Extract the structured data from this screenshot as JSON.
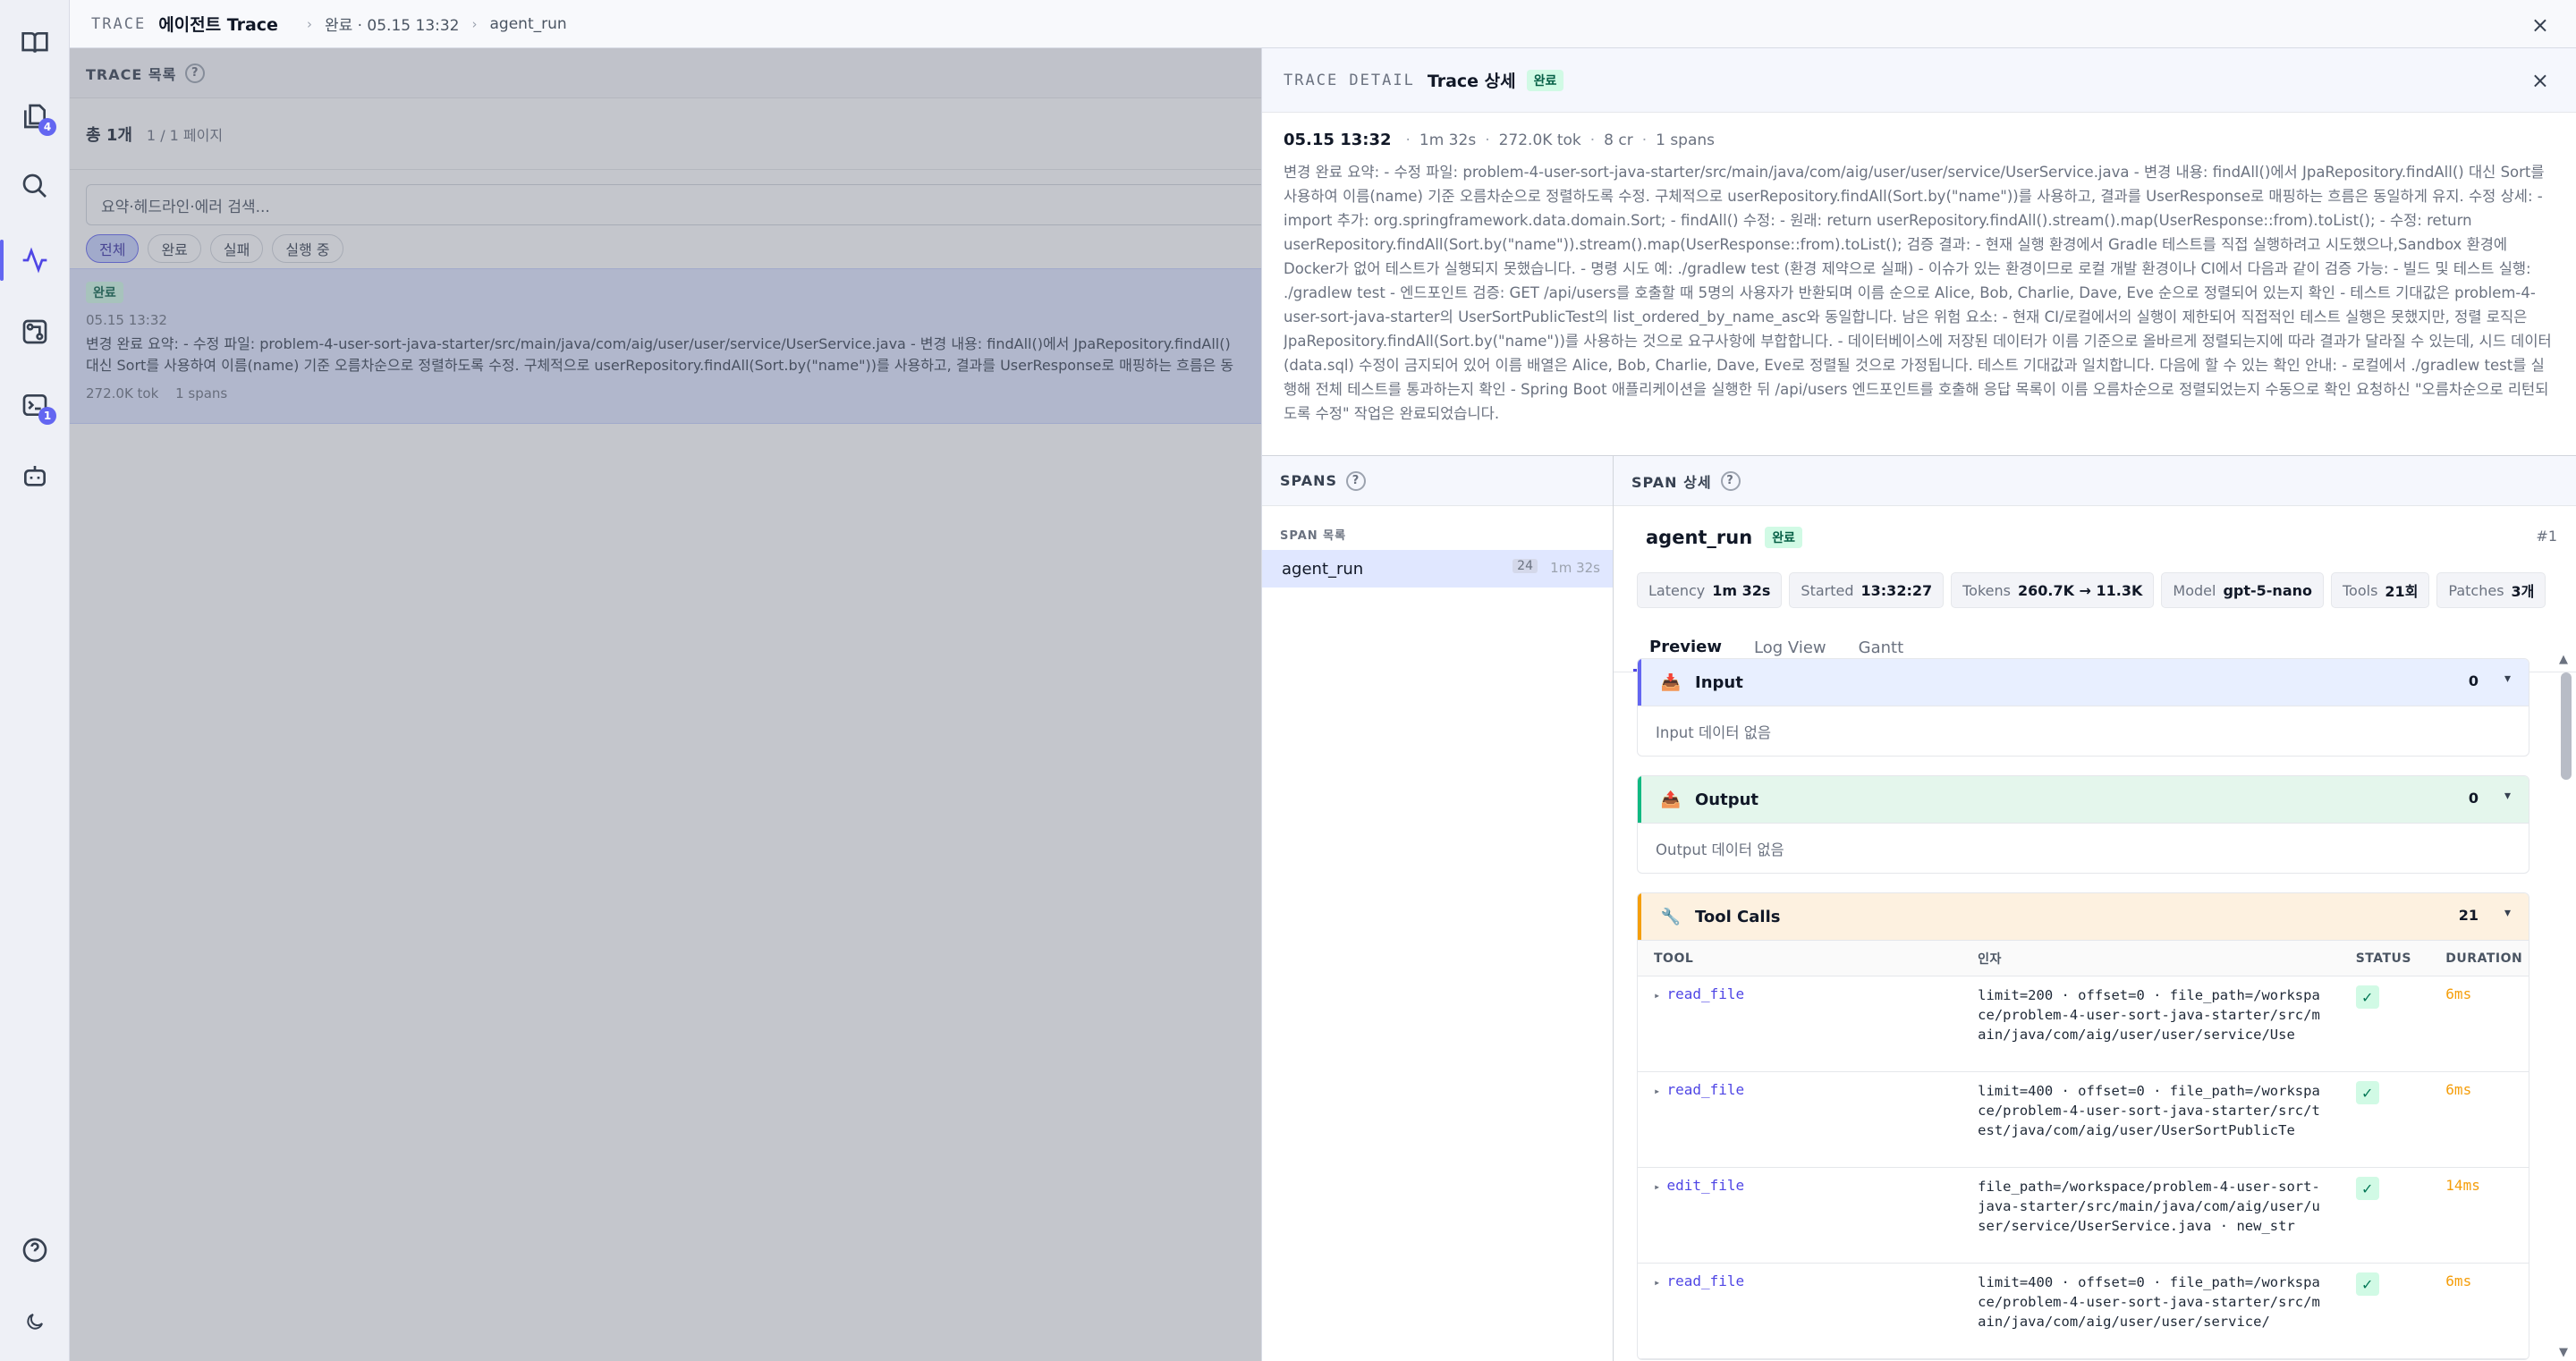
{
  "rail": {
    "badges": {
      "files": "4",
      "terminal": "1"
    }
  },
  "topbar": {
    "kicker": "TRACE",
    "title": "에이전트 Trace",
    "crumb_status": "완료 · 05.15 13:32",
    "crumb_span": "agent_run",
    "close": "×"
  },
  "list": {
    "header": "TRACE 목록",
    "total": "총 1개",
    "pages": "1 / 1 페이지",
    "search_placeholder": "요약·헤드라인·에러 검색...",
    "filters": [
      "전체",
      "완료",
      "실패",
      "실행 중"
    ],
    "row": {
      "status": "완료",
      "time": "05.15 13:32",
      "summary": "변경 완료 요약: - 수정 파일: problem-4-user-sort-java-starter/src/main/java/com/aig/user/user/service/UserService.java - 변경 내용: findAll()에서 JpaRepository.findAll() 대신 Sort를 사용하여 이름(name) 기준 오름차순으로 정렬하도록 수정. 구체적으로 userRepository.findAll(Sort.by(\"name\"))를 사용하고, 결과를 UserResponse로 매핑하는 흐름은 동일하게 유지. 수정 상세: - import 추가: org.springframework.data.domain.Sort; - findAll() 수정: - 원래: return userRepository.findAll().stream().map(UserResponse::from).toList(); - 수정: return userRepository.findAll(Sort.by(\"name\")).stream().map(UserResponse::from).toList();",
      "tokens": "272.0K tok",
      "spans": "1 spans"
    }
  },
  "detail": {
    "kicker": "TRACE DETAIL",
    "title": "Trace 상세",
    "status": "완료",
    "close": "×",
    "when": "05.15 13:32",
    "duration": "1m 32s",
    "tokens": "272.0K tok",
    "cr": "8 cr",
    "spans": "1 spans",
    "summary": "변경 완료 요약: - 수정 파일: problem-4-user-sort-java-starter/src/main/java/com/aig/user/user/service/UserService.java - 변경 내용: findAll()에서 JpaRepository.findAll() 대신 Sort를 사용하여 이름(name) 기준 오름차순으로 정렬하도록 수정. 구체적으로 userRepository.findAll(Sort.by(\"name\"))를 사용하고, 결과를 UserResponse로 매핑하는 흐름은 동일하게 유지. 수정 상세: - import 추가: org.springframework.data.domain.Sort; - findAll() 수정: - 원래: return userRepository.findAll().stream().map(UserResponse::from).toList(); - 수정: return userRepository.findAll(Sort.by(\"name\")).stream().map(UserResponse::from).toList(); 검증 결과: - 현재 실행 환경에서 Gradle 테스트를 직접 실행하려고 시도했으나,Sandbox 환경에 Docker가 없어 테스트가 실행되지 못했습니다. - 명령 시도 예: ./gradlew test (환경 제약으로 실패) - 이슈가 있는 환경이므로 로컬 개발 환경이나 CI에서 다음과 같이 검증 가능: - 빌드 및 테스트 실행: ./gradlew test - 엔드포인트 검증: GET /api/users를 호출할 때 5명의 사용자가 반환되며 이름 순으로 Alice, Bob, Charlie, Dave, Eve 순으로 정렬되어 있는지 확인 - 테스트 기대값은 problem-4-user-sort-java-starter의 UserSortPublicTest의 list_ordered_by_name_asc와 동일합니다. 남은 위험 요소: - 현재 CI/로컬에서의 실행이 제한되어 직접적인 테스트 실행은 못했지만, 정렬 로직은 JpaRepository.findAll(Sort.by(\"name\"))를 사용하는 것으로 요구사항에 부합합니다. - 데이터베이스에 저장된 데이터가 이름 기준으로 올바르게 정렬되는지에 따라 결과가 달라질 수 있는데, 시드 데이터(data.sql) 수정이 금지되어 있어 이름 배열은 Alice, Bob, Charlie, Dave, Eve로 정렬될 것으로 가정됩니다. 테스트 기대값과 일치합니다. 다음에 할 수 있는 확인 안내: - 로컬에서 ./gradlew test를 실행해 전체 테스트를 통과하는지 확인 - Spring Boot 애플리케이션을 실행한 뒤 /api/users 엔드포인트를 호출해 응답 목록이 이름 오름차순으로 정렬되었는지 수동으로 확인 요청하신 \"오름차순으로 리턴되도록 수정\" 작업은 완료되었습니다."
  },
  "spans_panel": {
    "header": "SPANS",
    "sub": "SPAN 목록",
    "items": [
      {
        "name": "agent_run",
        "count": "24",
        "duration": "1m 32s"
      }
    ]
  },
  "span_detail": {
    "header": "SPAN 상세",
    "name": "agent_run",
    "status": "완료",
    "index": "#1",
    "stats": [
      {
        "label": "Latency",
        "value": "1m 32s"
      },
      {
        "label": "Started",
        "value": "13:32:27"
      },
      {
        "label": "Tokens",
        "value": "260.7K → 11.3K"
      },
      {
        "label": "Model",
        "value": "gpt-5-nano"
      },
      {
        "label": "Tools",
        "value": "21회"
      },
      {
        "label": "Patches",
        "value": "3개"
      }
    ],
    "tabs": [
      "Preview",
      "Log View",
      "Gantt"
    ],
    "input": {
      "title": "Input",
      "count": "0",
      "empty": "Input 데이터 없음"
    },
    "output": {
      "title": "Output",
      "count": "0",
      "empty": "Output 데이터 없음"
    },
    "tools": {
      "title": "Tool Calls",
      "count": "21",
      "columns": [
        "TOOL",
        "인자",
        "STATUS",
        "DURATION"
      ],
      "rows": [
        {
          "tool": "read_file",
          "args": "limit=200 · offset=0 · file_path=/workspace/problem-4-user-sort-java-starter/src/main/java/com/aig/user/user/service/Use",
          "status": "✓",
          "duration": "6ms"
        },
        {
          "tool": "read_file",
          "args": "limit=400 · offset=0 · file_path=/workspace/problem-4-user-sort-java-starter/src/test/java/com/aig/user/UserSortPublicTe",
          "status": "✓",
          "duration": "6ms"
        },
        {
          "tool": "edit_file",
          "args": "file_path=/workspace/problem-4-user-sort-java-starter/src/main/java/com/aig/user/user/service/UserService.java · new_str",
          "status": "✓",
          "duration": "14ms"
        },
        {
          "tool": "read_file",
          "args": "limit=400 · offset=0 · file_path=/workspace/problem-4-user-sort-java-starter/src/main/java/com/aig/user/user/service/",
          "status": "✓",
          "duration": "6ms"
        }
      ]
    }
  }
}
